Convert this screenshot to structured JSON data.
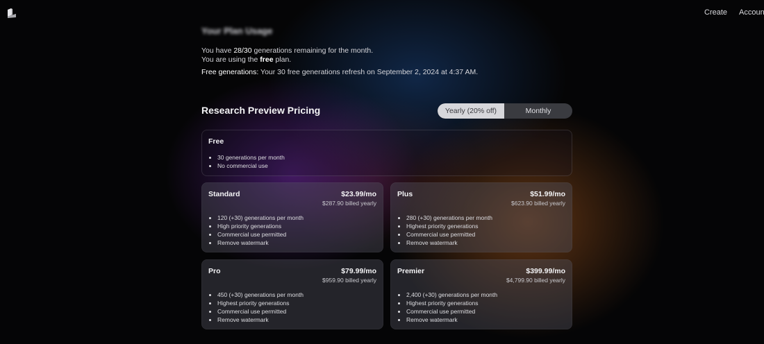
{
  "nav": {
    "create_label": "Create",
    "account_label": "Accoun"
  },
  "usage": {
    "title": "Your Plan Usage",
    "line1_pre": "You have ",
    "line1_count": "28/30",
    "line1_post": " generations remaining for the month.",
    "line2_pre": "You are using the ",
    "line2_plan": "free",
    "line2_post": " plan.",
    "line3_label": "Free generations:",
    "line3_text": " Your 30 free generations refresh on September 2, 2024 at 4:37 AM."
  },
  "pricing": {
    "title": "Research Preview Pricing",
    "toggle": {
      "yearly_label": "Yearly (20% off)",
      "monthly_label": "Monthly",
      "selected": "Yearly (20% off)"
    }
  },
  "free_plan": {
    "name": "Free",
    "features": [
      "30 generations per month",
      "No commercial use"
    ]
  },
  "plans": [
    {
      "name": "Standard",
      "price": "$23.99/mo",
      "billed": "$287.90 billed yearly",
      "features": [
        "120 (+30) generations per month",
        "High priority generations",
        "Commercial use permitted",
        "Remove watermark"
      ]
    },
    {
      "name": "Plus",
      "price": "$51.99/mo",
      "billed": "$623.90 billed yearly",
      "features": [
        "280 (+30) generations per month",
        "Highest priority generations",
        "Commercial use permitted",
        "Remove watermark"
      ]
    },
    {
      "name": "Pro",
      "price": "$79.99/mo",
      "billed": "$959.90 billed yearly",
      "features": [
        "450 (+30) generations per month",
        "Highest priority generations",
        "Commercial use permitted",
        "Remove watermark"
      ]
    },
    {
      "name": "Premier",
      "price": "$399.99/mo",
      "billed": "$4,799.90 billed yearly",
      "features": [
        "2,400 (+30) generations per month",
        "Highest priority generations",
        "Commercial use permitted",
        "Remove watermark"
      ]
    }
  ],
  "icons": {
    "logo": "app-logo-icon"
  }
}
